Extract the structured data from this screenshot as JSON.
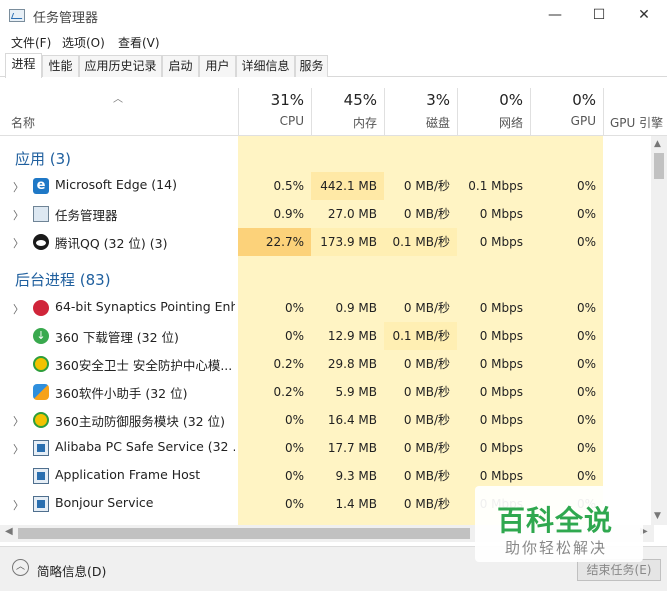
{
  "window": {
    "title": "任务管理器",
    "minimize": "—",
    "maximize": "☐",
    "close": "✕"
  },
  "menu": [
    "文件(F)",
    "选项(O)",
    "查看(V)"
  ],
  "tabs": [
    "进程",
    "性能",
    "应用历史记录",
    "启动",
    "用户",
    "详细信息",
    "服务"
  ],
  "active_tab": "进程",
  "columns": {
    "name": "名称",
    "cpu": {
      "pct": "31%",
      "label": "CPU"
    },
    "memory": {
      "pct": "45%",
      "label": "内存"
    },
    "disk": {
      "pct": "3%",
      "label": "磁盘"
    },
    "network": {
      "pct": "0%",
      "label": "网络"
    },
    "gpu": {
      "pct": "0%",
      "label": "GPU"
    },
    "gpu_engine": {
      "label": "GPU 引擎"
    }
  },
  "groups": {
    "apps": "应用 (3)",
    "background": "后台进程 (83)"
  },
  "processes": [
    {
      "name": "Microsoft Edge (14)",
      "icon": "edge-icon",
      "cpu": "0.5%",
      "memory": "442.1 MB",
      "disk": "0 MB/秒",
      "network": "0.1 Mbps",
      "gpu": "0%"
    },
    {
      "name": "任务管理器",
      "icon": "task-manager-icon",
      "cpu": "0.9%",
      "memory": "27.0 MB",
      "disk": "0 MB/秒",
      "network": "0 Mbps",
      "gpu": "0%"
    },
    {
      "name": "腾讯QQ (32 位) (3)",
      "icon": "qq-icon",
      "cpu": "22.7%",
      "memory": "173.9 MB",
      "disk": "0.1 MB/秒",
      "network": "0 Mbps",
      "gpu": "0%"
    },
    {
      "name": "64-bit Synaptics Pointing Enh...",
      "icon": "synaptics-icon",
      "cpu": "0%",
      "memory": "0.9 MB",
      "disk": "0 MB/秒",
      "network": "0 Mbps",
      "gpu": "0%"
    },
    {
      "name": "360 下载管理 (32 位)",
      "icon": "download-icon",
      "cpu": "0%",
      "memory": "12.9 MB",
      "disk": "0.1 MB/秒",
      "network": "0 Mbps",
      "gpu": "0%"
    },
    {
      "name": "360安全卫士 安全防护中心模...",
      "icon": "360-guard-icon",
      "cpu": "0.2%",
      "memory": "29.8 MB",
      "disk": "0 MB/秒",
      "network": "0 Mbps",
      "gpu": "0%"
    },
    {
      "name": "360软件小助手 (32 位)",
      "icon": "360-software-icon",
      "cpu": "0.2%",
      "memory": "5.9 MB",
      "disk": "0 MB/秒",
      "network": "0 Mbps",
      "gpu": "0%"
    },
    {
      "name": "360主动防御服务模块 (32 位)",
      "icon": "360-defense-icon",
      "cpu": "0%",
      "memory": "16.4 MB",
      "disk": "0 MB/秒",
      "network": "0 Mbps",
      "gpu": "0%"
    },
    {
      "name": "Alibaba PC Safe Service (32 ...",
      "icon": "window-app-icon",
      "cpu": "0%",
      "memory": "17.7 MB",
      "disk": "0 MB/秒",
      "network": "0 Mbps",
      "gpu": "0%"
    },
    {
      "name": "Application Frame Host",
      "icon": "window-app-icon",
      "cpu": "0%",
      "memory": "9.3 MB",
      "disk": "0 MB/秒",
      "network": "0 Mbps",
      "gpu": "0%"
    },
    {
      "name": "Bonjour Service",
      "icon": "window-app-icon",
      "cpu": "0%",
      "memory": "1.4 MB",
      "disk": "0 MB/秒",
      "network": "0 Mbps",
      "gpu": "0%"
    }
  ],
  "footer": {
    "fewer_details": "简略信息(D)",
    "end_task": "结束任务(E)"
  },
  "watermark": {
    "title": "百科全说",
    "subtitle": "助你轻松解决"
  },
  "colors": {
    "heat_light": "#fff4c4",
    "heat_mid": "#ffe9a6",
    "heat_high": "#fcd27a",
    "group_title": "#1f5f9e",
    "watermark_green": "#2fa84f"
  }
}
